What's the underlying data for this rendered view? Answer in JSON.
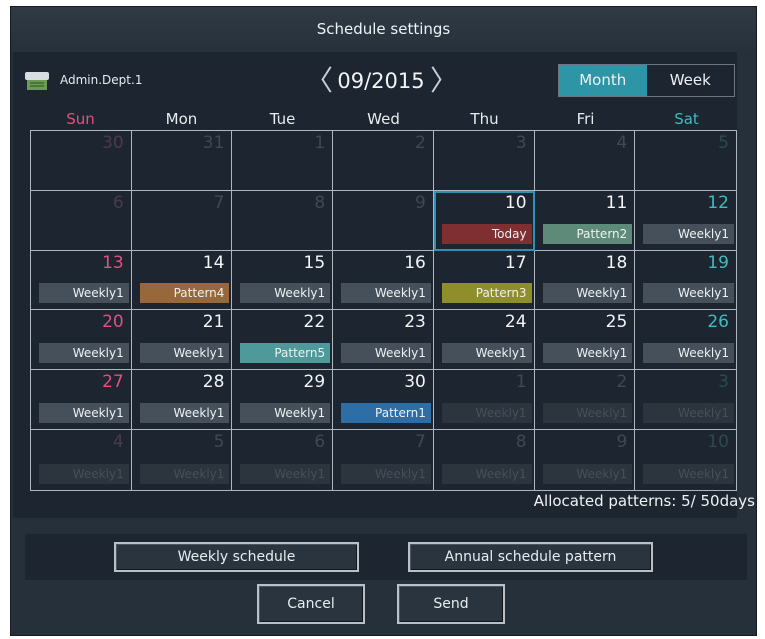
{
  "window": {
    "title": "Schedule settings"
  },
  "header": {
    "group_name": "Admin.Dept.1",
    "month": "09/2015"
  },
  "view_toggle": {
    "month_label": "Month",
    "week_label": "Week",
    "selected": "Month"
  },
  "days_of_week": [
    "Sun",
    "Mon",
    "Tue",
    "Wed",
    "Thu",
    "Fri",
    "Sat"
  ],
  "calendar": [
    {
      "day": "30",
      "other": true,
      "tag": ""
    },
    {
      "day": "31",
      "other": true,
      "tag": ""
    },
    {
      "day": "1",
      "other": true,
      "tag": ""
    },
    {
      "day": "2",
      "other": true,
      "tag": ""
    },
    {
      "day": "3",
      "other": true,
      "tag": ""
    },
    {
      "day": "4",
      "other": true,
      "tag": ""
    },
    {
      "day": "5",
      "other": true,
      "tag": ""
    },
    {
      "day": "6",
      "other": true,
      "tag": ""
    },
    {
      "day": "7",
      "other": true,
      "tag": ""
    },
    {
      "day": "8",
      "other": true,
      "tag": ""
    },
    {
      "day": "9",
      "other": true,
      "tag": ""
    },
    {
      "day": "10",
      "today": true,
      "tag": "Today",
      "color": "#7f2e31"
    },
    {
      "day": "11",
      "tag": "Pattern2",
      "color": "#5e8a7a"
    },
    {
      "day": "12",
      "tag": "Weekly1",
      "color": "#46505a"
    },
    {
      "day": "13",
      "tag": "Weekly1",
      "color": "#46505a"
    },
    {
      "day": "14",
      "tag": "Pattern4",
      "color": "#96683c"
    },
    {
      "day": "15",
      "tag": "Weekly1",
      "color": "#46505a"
    },
    {
      "day": "16",
      "tag": "Weekly1",
      "color": "#46505a"
    },
    {
      "day": "17",
      "tag": "Pattern3",
      "color": "#8e8e2b"
    },
    {
      "day": "18",
      "tag": "Weekly1",
      "color": "#46505a"
    },
    {
      "day": "19",
      "tag": "Weekly1",
      "color": "#46505a"
    },
    {
      "day": "20",
      "tag": "Weekly1",
      "color": "#46505a"
    },
    {
      "day": "21",
      "tag": "Weekly1",
      "color": "#46505a"
    },
    {
      "day": "22",
      "tag": "Pattern5",
      "color": "#4e9a9a"
    },
    {
      "day": "23",
      "tag": "Weekly1",
      "color": "#46505a"
    },
    {
      "day": "24",
      "tag": "Weekly1",
      "color": "#46505a"
    },
    {
      "day": "25",
      "tag": "Weekly1",
      "color": "#46505a"
    },
    {
      "day": "26",
      "tag": "Weekly1",
      "color": "#46505a"
    },
    {
      "day": "27",
      "tag": "Weekly1",
      "color": "#46505a"
    },
    {
      "day": "28",
      "tag": "Weekly1",
      "color": "#46505a"
    },
    {
      "day": "29",
      "tag": "Weekly1",
      "color": "#46505a"
    },
    {
      "day": "30",
      "tag": "Pattern1",
      "color": "#2d6ea6"
    },
    {
      "day": "1",
      "other": true,
      "tag": "Weekly1",
      "color": "#2c343d"
    },
    {
      "day": "2",
      "other": true,
      "tag": "Weekly1",
      "color": "#2c343d"
    },
    {
      "day": "3",
      "other": true,
      "tag": "Weekly1",
      "color": "#2c343d"
    },
    {
      "day": "4",
      "other": true,
      "tag": "Weekly1",
      "color": "#2c343d"
    },
    {
      "day": "5",
      "other": true,
      "tag": "Weekly1",
      "color": "#2c343d"
    },
    {
      "day": "6",
      "other": true,
      "tag": "Weekly1",
      "color": "#2c343d"
    },
    {
      "day": "7",
      "other": true,
      "tag": "Weekly1",
      "color": "#2c343d"
    },
    {
      "day": "8",
      "other": true,
      "tag": "Weekly1",
      "color": "#2c343d"
    },
    {
      "day": "9",
      "other": true,
      "tag": "Weekly1",
      "color": "#2c343d"
    },
    {
      "day": "10",
      "other": true,
      "tag": "Weekly1",
      "color": "#2c343d"
    }
  ],
  "allocated": "Allocated patterns: 5/ 50days",
  "buttons": {
    "weekly_schedule": "Weekly schedule",
    "annual_pattern": "Annual schedule pattern",
    "cancel": "Cancel",
    "send": "Send"
  },
  "icons": {
    "group": "air-conditioner-icon",
    "prev": "chevron-left-icon",
    "next": "chevron-right-icon"
  },
  "colors": {
    "accent": "#2e95a6",
    "sunday": "#e2507f",
    "saturday": "#3fbcc0"
  }
}
